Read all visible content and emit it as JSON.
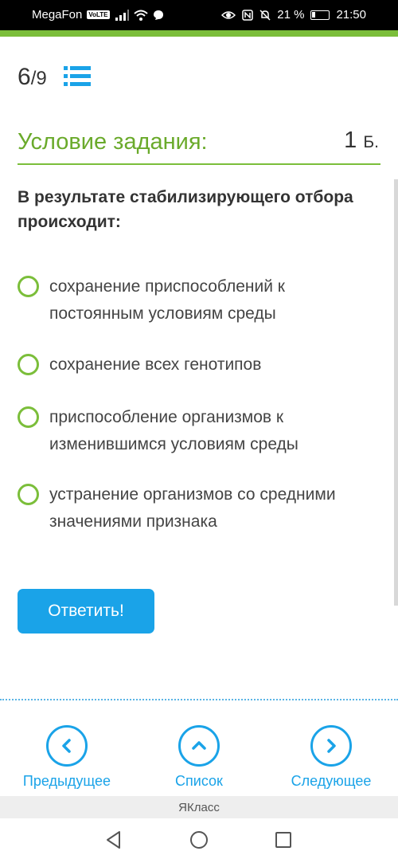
{
  "status_bar": {
    "carrier": "MegaFon",
    "volte": "VoLTE",
    "battery_percent": "21 %",
    "battery_level": 0.21,
    "time": "21:50"
  },
  "header": {
    "progress_current": "6",
    "progress_total": "/9",
    "condition_title": "Условие задания:",
    "points_value": "1",
    "points_unit": "Б."
  },
  "question": {
    "text": "В результате стабилизирующего отбора происходит:",
    "options": [
      "сохранение приспособлений к постоянным условиям среды",
      "сохранение всех генотипов",
      "приспособление организмов к изменившимся условиям среды",
      "устранение организмов со средними значениями признака"
    ]
  },
  "answer_button": "Ответить!",
  "bottom_nav": {
    "prev_label": "Предыдущее",
    "list_label": "Список",
    "next_label": "Следующее"
  },
  "footer": {
    "brand": "ЯКласс"
  },
  "colors": {
    "accent_green": "#7bbe3a",
    "accent_blue": "#1aa3e8"
  }
}
